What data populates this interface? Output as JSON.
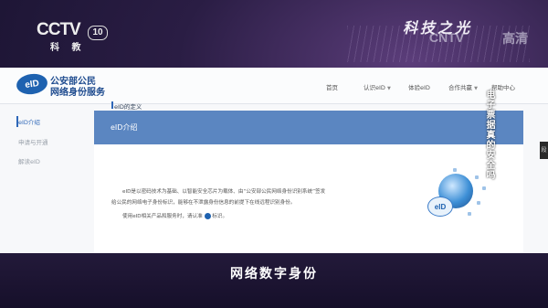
{
  "channel": {
    "logo": "CCTV",
    "number": "10",
    "name": "科 教"
  },
  "program": {
    "title": "科技之光",
    "hd_logo": "CNTV",
    "hd_label": "高清"
  },
  "website": {
    "logo_text": "eID",
    "org_line1": "公安部公民",
    "org_line2": "网络身份服务",
    "nav": [
      {
        "label": "首页",
        "dropdown": false
      },
      {
        "label": "认识eID",
        "dropdown": true
      },
      {
        "label": "体验eID",
        "dropdown": false
      },
      {
        "label": "合作共赢",
        "dropdown": true
      },
      {
        "label": "帮助中心",
        "dropdown": false
      }
    ],
    "dropdown_glyph": "▼",
    "sidebar": [
      "eID介绍",
      "申请与开通",
      "解读eID"
    ],
    "banner_title": "eID介绍",
    "definition_title": "eID的定义",
    "paragraph_lines": [
      "eID是以密码技术为基础、以智能安全芯片为载体、由“公安部公民网络身份识别系统”签发",
      "给公民的网络电子身份标识，能够在不泄露身份信息的前提下在线远程识别身份。",
      "使用eID相关产品和服务时，请认准",
      "标识。"
    ],
    "illustration_label": "eID"
  },
  "vertical_caption": "电子票据真的安全吗",
  "right_tab": "段",
  "subtitle": "网络数字身份"
}
